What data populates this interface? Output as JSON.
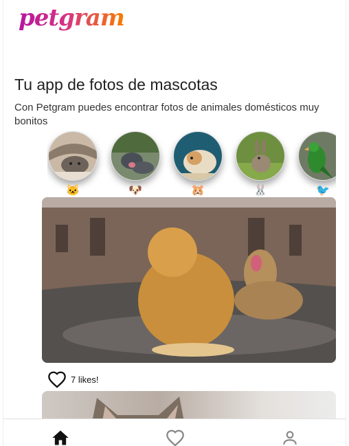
{
  "header": {
    "logo_text": "petgram"
  },
  "hero": {
    "title": "Tu app de fotos de mascotas",
    "subtitle": "Con Petgram puedes encontrar fotos de animales domésticos muy bonitos"
  },
  "categories": [
    {
      "emoji": "🐱",
      "animal": "cat"
    },
    {
      "emoji": "🐶",
      "animal": "dog"
    },
    {
      "emoji": "🐹",
      "animal": "hamster"
    },
    {
      "emoji": "🐰",
      "animal": "rabbit"
    },
    {
      "emoji": "🐦",
      "animal": "bird"
    }
  ],
  "feed": {
    "card1": {
      "likes_label": "7 likes!"
    }
  },
  "nav": {
    "items": [
      {
        "icon": "home-icon",
        "active": true
      },
      {
        "icon": "heart-icon",
        "active": false
      },
      {
        "icon": "user-icon",
        "active": false
      }
    ]
  },
  "colors": {
    "accent_start": "#b5179e",
    "accent_end": "#f77f00",
    "icon_active": "#111111",
    "icon_inactive": "#888888"
  }
}
